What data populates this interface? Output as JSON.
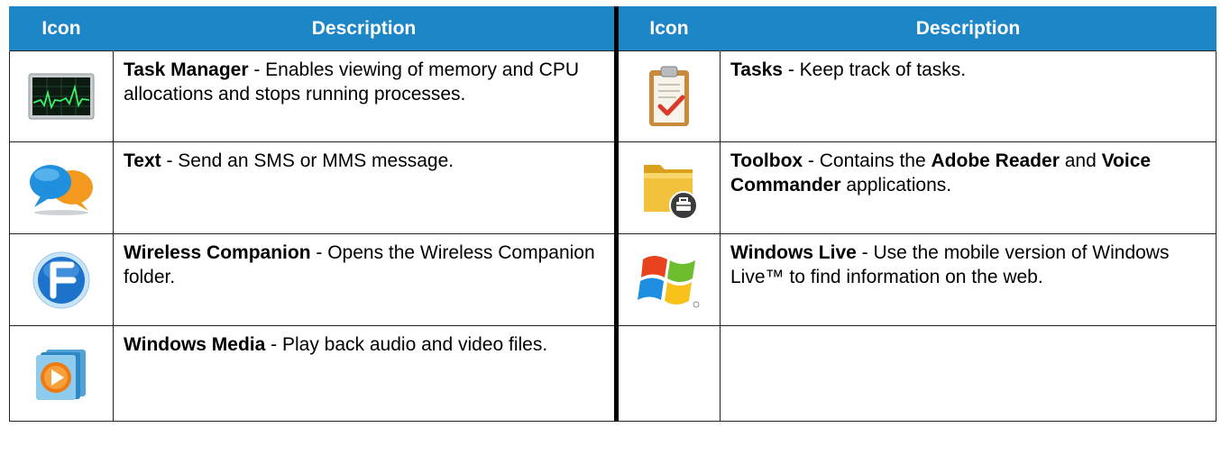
{
  "header": {
    "icon_col": "Icon",
    "desc_col": "Description"
  },
  "rows": [
    {
      "left": {
        "icon": "task-manager-icon",
        "name": "Task Manager",
        "desc": " - Enables viewing of memory and CPU allocations and stops running processes."
      },
      "right": {
        "icon": "tasks-icon",
        "name": "Tasks",
        "desc": " - Keep track of tasks."
      }
    },
    {
      "left": {
        "icon": "text-messaging-icon",
        "name": "Text",
        "desc": " - Send an SMS or MMS message."
      },
      "right": {
        "icon": "toolbox-icon",
        "name": "Toolbox",
        "desc_1": " - Contains the ",
        "bold_2": "Adobe Reader",
        "desc_3": " and ",
        "bold_4": "Voice Commander",
        "desc_5": " applications."
      }
    },
    {
      "left": {
        "icon": "wireless-companion-icon",
        "name": "Wireless Companion",
        "desc": " - Opens the Wireless Companion folder."
      },
      "right": {
        "icon": "windows-live-icon",
        "name": "Windows Live",
        "desc": " - Use the mobile version of Windows Live™ to find information on the web."
      }
    },
    {
      "left": {
        "icon": "windows-media-icon",
        "name": "Windows Media",
        "desc": " - Play back audio and video files."
      },
      "right": null
    }
  ],
  "colors": {
    "header_bg": "#1c86c6",
    "header_text": "#ffffff"
  }
}
